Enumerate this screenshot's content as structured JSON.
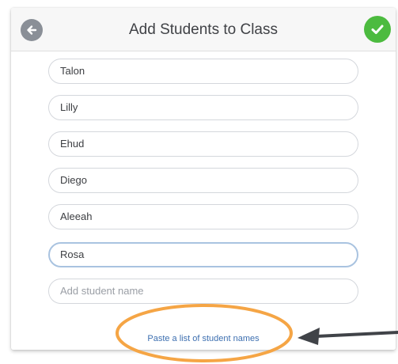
{
  "header": {
    "title": "Add Students to Class",
    "back_icon": "arrow-left-icon",
    "done_icon": "checkmark-icon"
  },
  "students": {
    "names": [
      "Talon",
      "Lilly",
      "Ehud",
      "Diego",
      "Aleeah",
      "Rosa"
    ],
    "focused_name": "Rosa",
    "new_name_placeholder": "Add student name"
  },
  "paste_link_label": "Paste a list of student names",
  "annotation": {
    "shape": "ellipse-highlight-with-arrow",
    "highlight_color": "#f5a545",
    "arrow_color": "#404348"
  },
  "colors": {
    "done_green": "#4cbb3f",
    "back_gray": "#8a8f97",
    "link_blue": "#3d6fb0",
    "focus_border": "#a9c3e0"
  }
}
